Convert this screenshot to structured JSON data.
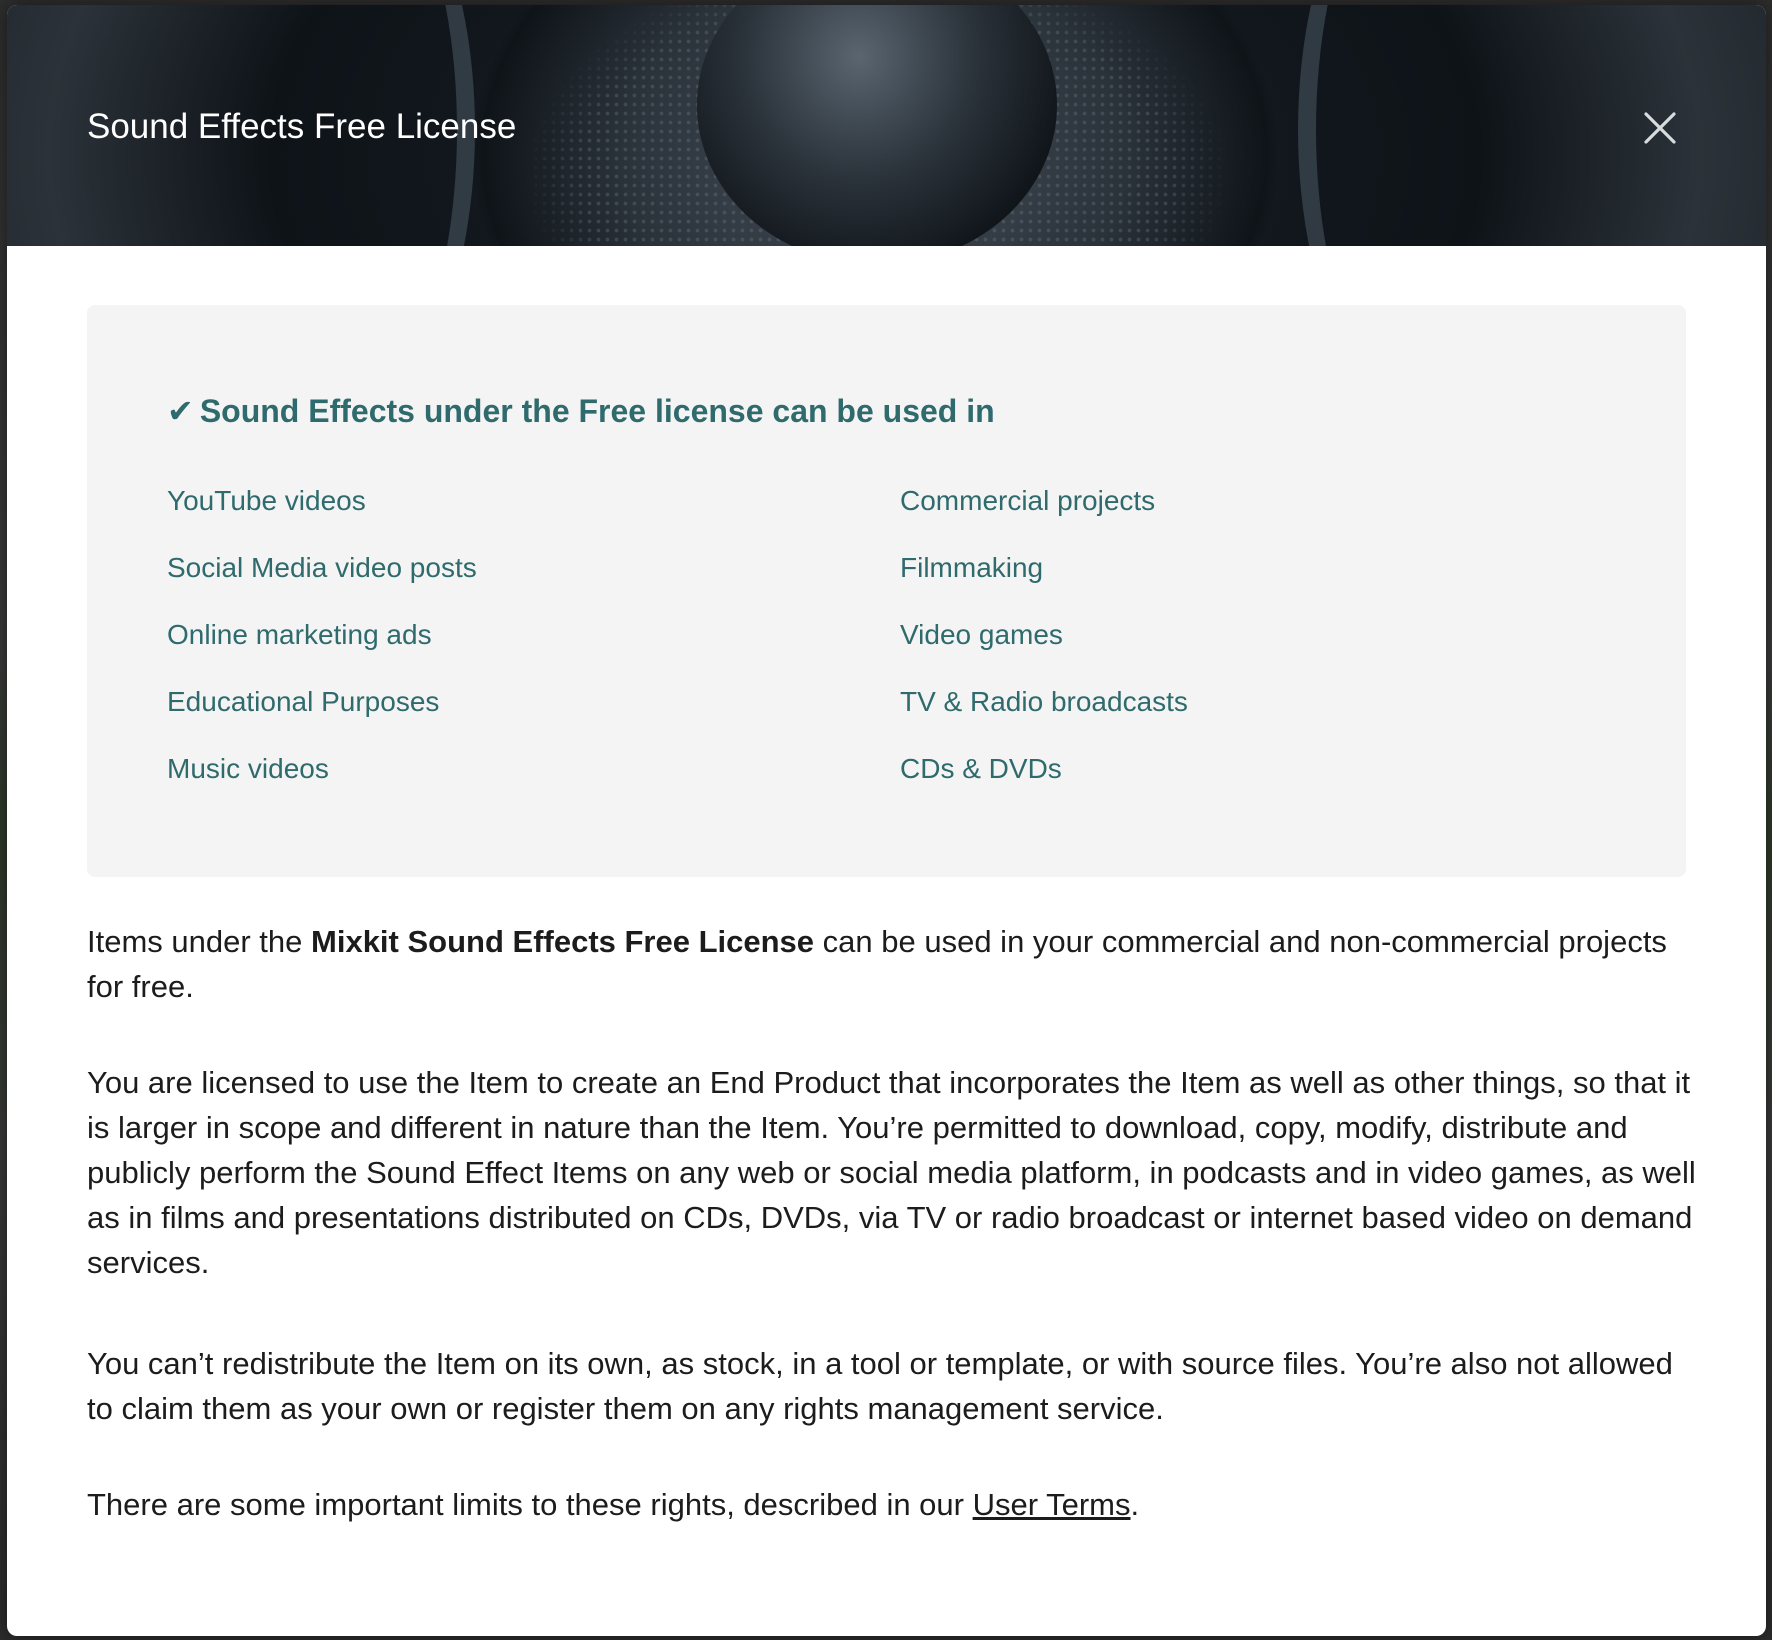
{
  "modal": {
    "title": "Sound Effects Free License",
    "close_icon": "close-icon"
  },
  "usage": {
    "check_glyph": "✔",
    "heading": "Sound Effects under the Free license can be used in",
    "items_left": [
      "YouTube videos",
      "Social Media video posts",
      "Online marketing ads",
      "Educational Purposes",
      "Music videos"
    ],
    "items_right": [
      "Commercial projects",
      "Filmmaking",
      "Video games",
      "TV & Radio broadcasts",
      "CDs & DVDs"
    ]
  },
  "paragraphs": {
    "p1_prefix": "Items under the ",
    "p1_bold": "Mixkit Sound Effects Free License",
    "p1_suffix": " can be used in your commercial and non-commercial projects for free.",
    "p2": "You are licensed to use the Item to create an End Product that incorporates the Item as well as other things, so that it is larger in scope and different in nature than the Item. You’re permitted to download, copy, modify, distribute and publicly perform the Sound Effect Items on any web or social media platform, in podcasts and in video games, as well as in films and presentations distributed on CDs, DVDs, via TV or radio broadcast or internet based video on demand services.",
    "p3": "You can’t redistribute the Item on its own, as stock, in a tool or template, or with source files. You’re also not allowed to claim them as your own or register them on any rights management service.",
    "p4_prefix": "There are some important limits to these rights, described in our ",
    "p4_link": "User Terms",
    "p4_suffix": "."
  },
  "colors": {
    "accent_teal": "#2f6a6c",
    "box_background": "#f4f4f4",
    "text": "#1c1c1c"
  }
}
